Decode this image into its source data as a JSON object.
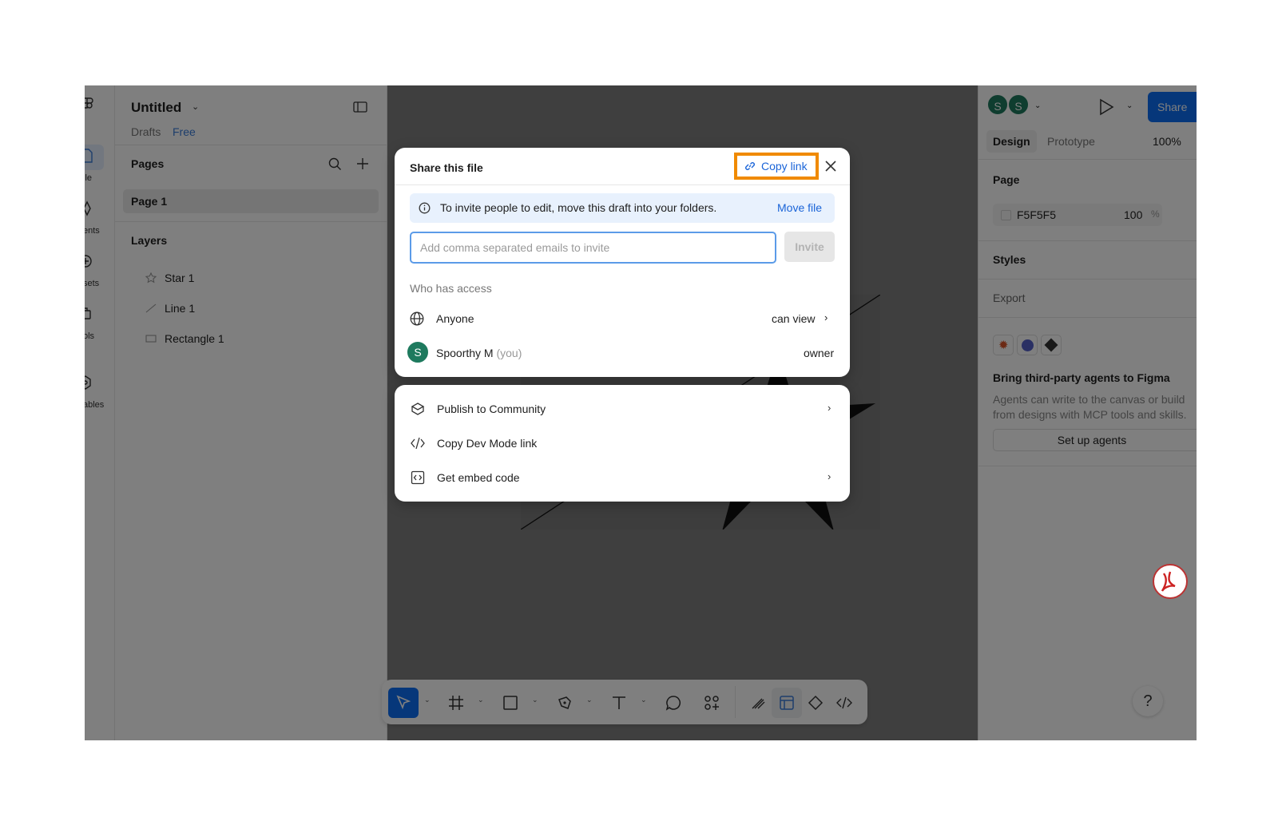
{
  "app": {
    "file_title": "Untitled",
    "location": "Drafts",
    "plan_badge": "Free"
  },
  "rail": {
    "items": [
      {
        "label": "ile"
      },
      {
        "label": "ents"
      },
      {
        "label": "sets"
      },
      {
        "label": "ols"
      },
      {
        "label": "ables"
      }
    ]
  },
  "left_panel": {
    "pages_title": "Pages",
    "pages": [
      "Page 1"
    ],
    "layers_title": "Layers",
    "layers": [
      {
        "name": "Star 1",
        "icon": "star-icon"
      },
      {
        "name": "Line 1",
        "icon": "line-icon"
      },
      {
        "name": "Rectangle 1",
        "icon": "rectangle-icon"
      }
    ]
  },
  "right_panel": {
    "avatars": [
      "S",
      "S"
    ],
    "share_label": "Share",
    "tabs": [
      "Design",
      "Prototype"
    ],
    "zoom": "100%",
    "page_section": "Page",
    "page_color": "F5F5F5",
    "page_opacity": "100",
    "page_opacity_unit": "%",
    "styles_section": "Styles",
    "export_section": "Export",
    "agents_title": "Bring third-party agents to Figma",
    "agents_desc": "Agents can write to the canvas or build from designs with MCP tools and skills.",
    "agents_button": "Set up agents"
  },
  "share_dialog": {
    "title": "Share this file",
    "copy_link": "Copy link",
    "info_text": "To invite people to edit, move this draft into your folders.",
    "move_file": "Move file",
    "invite_placeholder": "Add comma separated emails to invite",
    "invite_button": "Invite",
    "access_title": "Who has access",
    "access": [
      {
        "name": "Anyone",
        "role": "can view"
      },
      {
        "name": "Spoorthy M",
        "suffix": "(you)",
        "role": "owner",
        "avatar": "S"
      }
    ]
  },
  "share_menu": {
    "items": [
      {
        "label": "Publish to Community",
        "icon": "community-icon",
        "has_chevron": true
      },
      {
        "label": "Copy Dev Mode link",
        "icon": "code-icon",
        "has_chevron": false
      },
      {
        "label": "Get embed code",
        "icon": "embed-icon",
        "has_chevron": true
      }
    ]
  },
  "help_label": "?",
  "colors": {
    "accent": "#0d6ef5",
    "highlight_border": "#f08a00",
    "avatar": "#1e7a5e"
  }
}
